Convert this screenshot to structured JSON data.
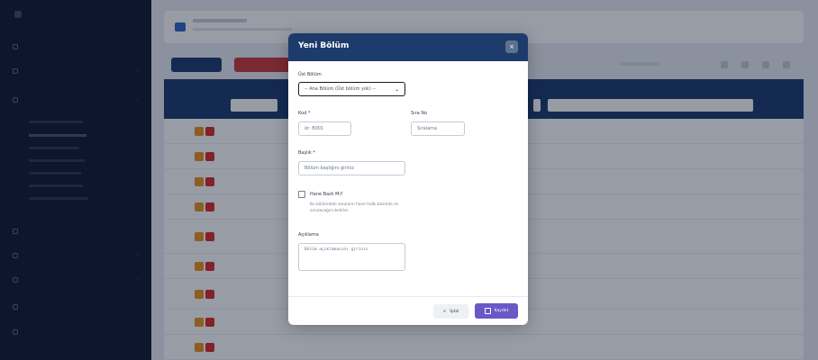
{
  "modal": {
    "title": "Yeni Bölüm",
    "close_label": "×",
    "parent_section": {
      "label": "Üst Bölüm",
      "selected": "-- Ana Bölüm (Üst bölüm yok) --"
    },
    "code": {
      "label": "Kod *",
      "placeholder": "ör: B001"
    },
    "order": {
      "label": "Sıra No",
      "placeholder": "Sıralama"
    },
    "title_field": {
      "label": "Başlık *",
      "placeholder": "Bölüm başlığını giriniz"
    },
    "household": {
      "label": "Hane Bazlı Mı?",
      "help": "Bu bölümdeki soruların hane halkı bazında mı sorulacağını belirler.",
      "checked": false
    },
    "description": {
      "label": "Açıklama",
      "placeholder": "Bölüm açıklamasını giriniz"
    },
    "cancel_label": "İptal",
    "cancel_icon": "×",
    "save_label": "Kaydet"
  },
  "colors": {
    "modal_header": "#1d3b6b",
    "save_button": "#6b58c7",
    "sidebar": "#0e1a31",
    "table_header": "#1c3b6e"
  }
}
